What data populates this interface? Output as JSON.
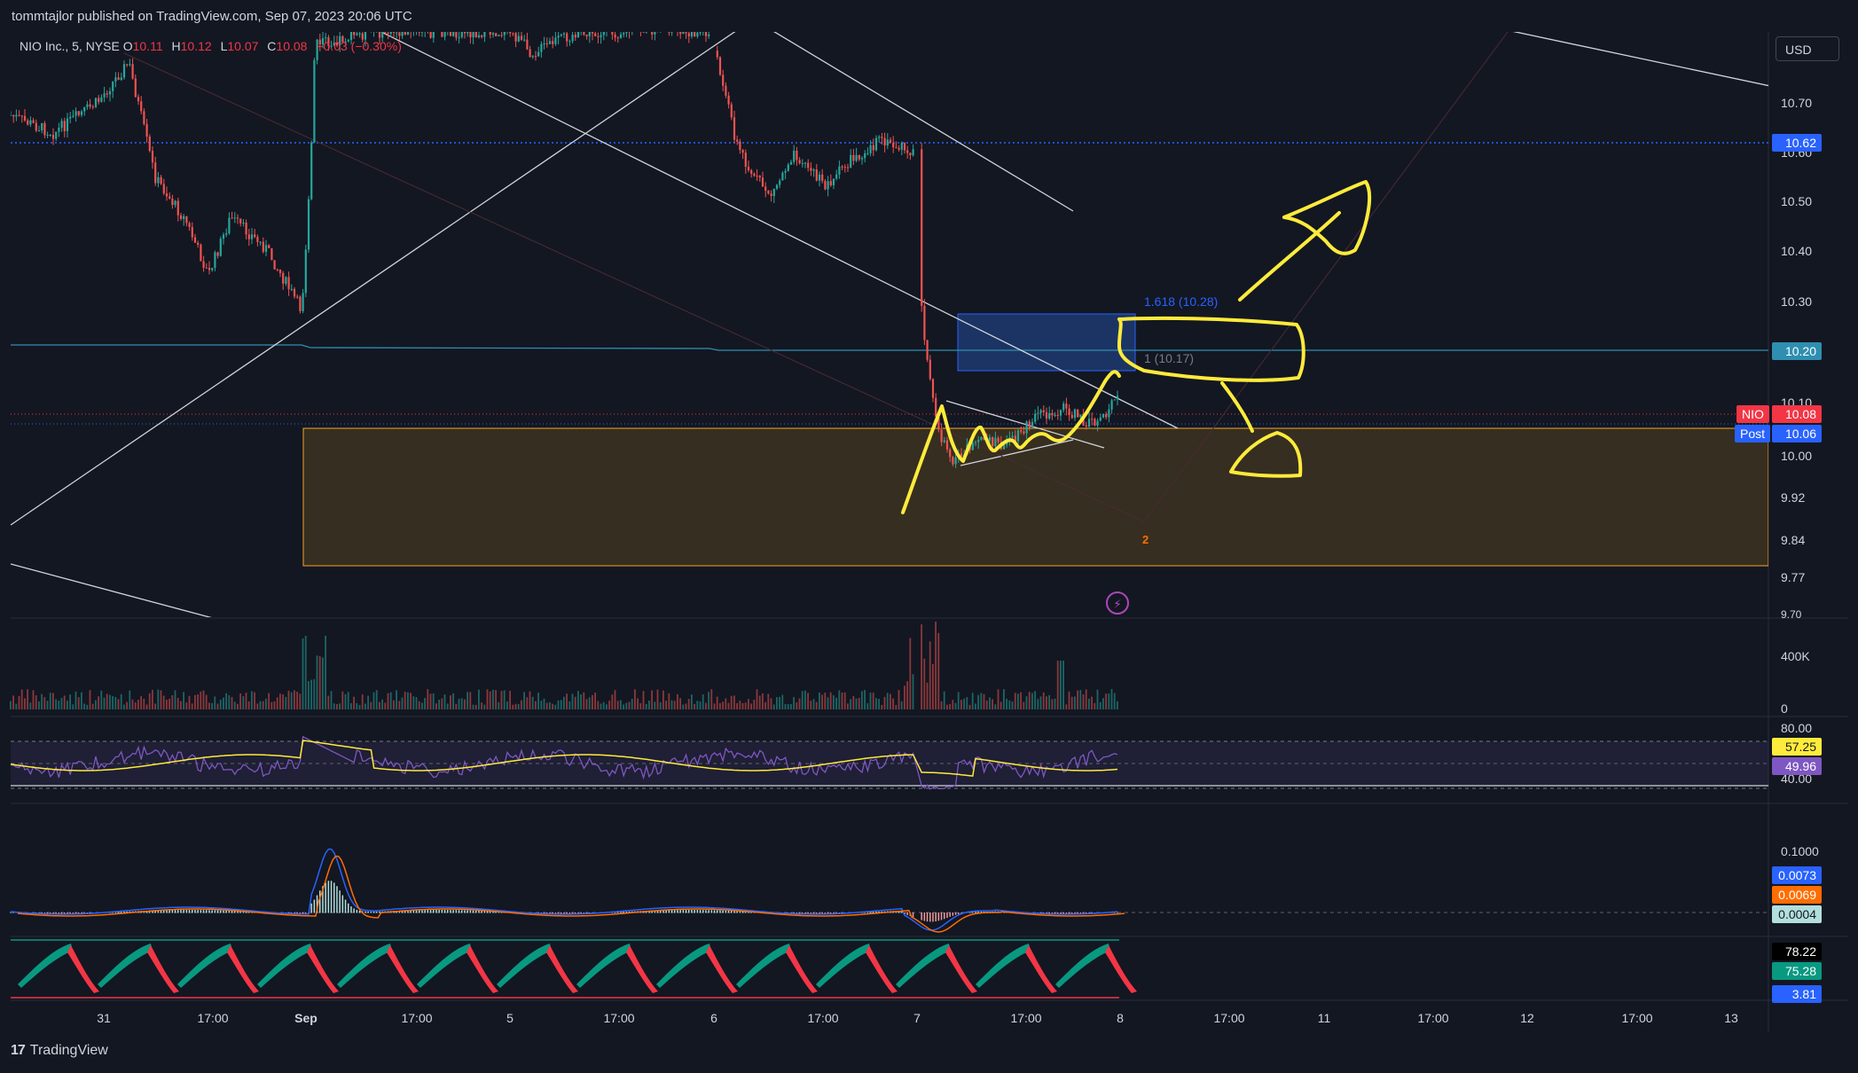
{
  "header": {
    "published": "tommtajlor published on TradingView.com, Sep 07, 2023 20:06 UTC"
  },
  "legend": {
    "symbol": "NIO Inc., 5, NYSE",
    "o_label": "O",
    "o_value": "10.11",
    "h_label": "H",
    "h_value": "10.12",
    "l_label": "L",
    "l_value": "10.07",
    "c_label": "C",
    "c_value": "10.08",
    "change": "−0.03 (−0.30%)"
  },
  "currency_button": "USD",
  "price_axis": {
    "labels": [
      "10.70",
      "10.60",
      "10.50",
      "10.40",
      "10.30",
      "10.10",
      "10.00",
      "9.92",
      "9.84",
      "9.77",
      "9.70"
    ],
    "badges": {
      "level_1062": "10.62",
      "level_1020": "10.20",
      "nio_tag": "NIO",
      "nio_value": "10.08",
      "post_tag": "Post",
      "post_value": "10.06"
    }
  },
  "fib": {
    "level_1618": "1.618 (10.28)",
    "level_1": "1 (10.17)",
    "point_2": "2"
  },
  "volume_axis": {
    "labels": [
      "400K",
      "0"
    ]
  },
  "rsi_axis": {
    "labels": [
      "80.00",
      "40.00"
    ],
    "badge_1": "57.25",
    "badge_2": "49.96"
  },
  "macd_axis": {
    "labels": [
      "0.1000"
    ],
    "badge_1": "0.0073",
    "badge_2": "0.0069",
    "badge_3": "0.0004"
  },
  "osc_axis": {
    "badge_1": "78.22",
    "badge_2": "75.28",
    "badge_3": "3.81"
  },
  "time_axis": [
    "31",
    "17:00",
    "Sep",
    "17:00",
    "5",
    "17:00",
    "6",
    "17:00",
    "7",
    "17:00",
    "8",
    "17:00",
    "11",
    "17:00",
    "12",
    "17:00",
    "13"
  ],
  "footer": {
    "brand": "TradingView"
  },
  "colors": {
    "background": "#131722",
    "up": "#26a69a",
    "down": "#ef5350",
    "annotation": "#ffeb3b",
    "zone_fill": "#3d3220",
    "zone_border": "#f5a623",
    "fib_box": "#1e3a6e",
    "rsi_line": "#7e57c2",
    "macd_blue": "#2962ff",
    "macd_orange": "#ff6d00"
  }
}
